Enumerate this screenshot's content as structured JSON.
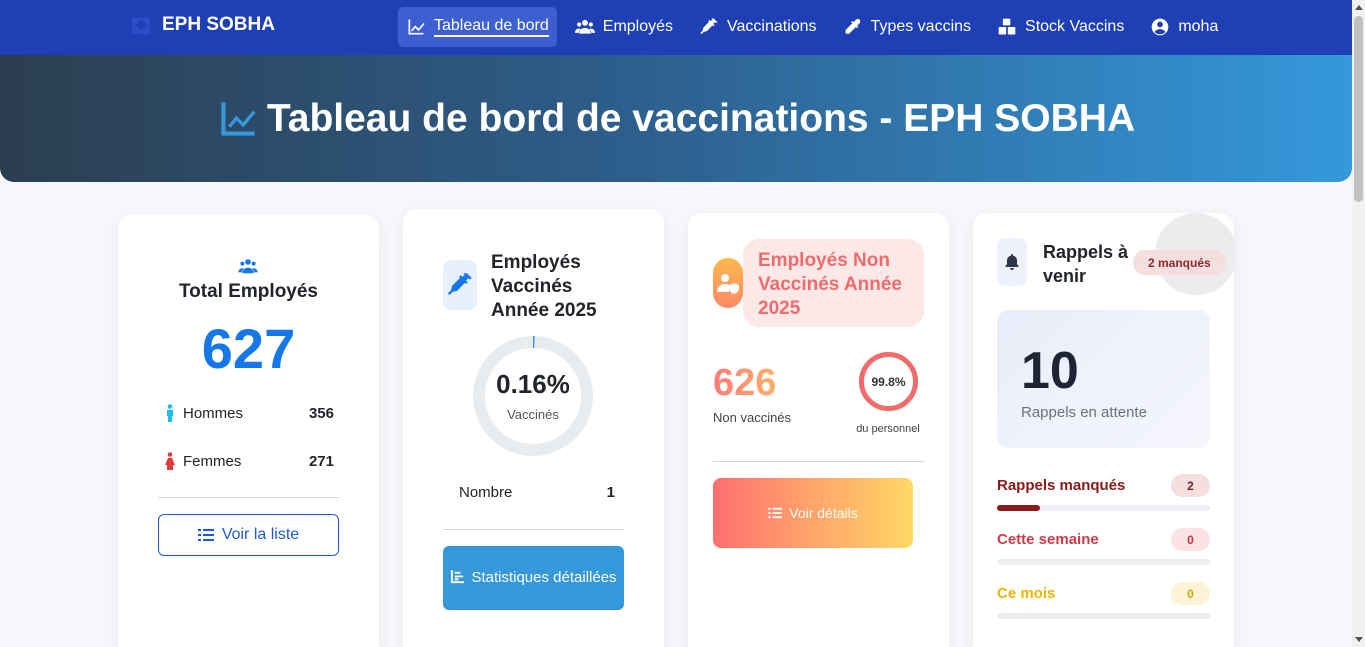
{
  "brand": {
    "name": "EPH SOBHA",
    "icon": "hospital-icon"
  },
  "nav": [
    {
      "label": "Tableau de bord",
      "icon": "chart-line-icon",
      "active": true
    },
    {
      "label": "Employés",
      "icon": "users-icon"
    },
    {
      "label": "Vaccinations",
      "icon": "syringe-icon"
    },
    {
      "label": "Types vaccins",
      "icon": "eyedropper-icon"
    },
    {
      "label": "Stock Vaccins",
      "icon": "boxes-icon"
    },
    {
      "label": "moha",
      "icon": "user-circle-icon"
    }
  ],
  "hero": {
    "title": "Tableau de bord de vaccinations - EPH SOBHA",
    "icon": "chart-line-icon"
  },
  "total": {
    "title": "Total Employés",
    "count": "627",
    "men_label": "Hommes",
    "men_value": "356",
    "women_label": "Femmes",
    "women_value": "271",
    "button": "Voir la liste"
  },
  "vaccinated": {
    "title": "Employés Vaccinés Année 2025",
    "percent": "0.16%",
    "percent_value": 0.16,
    "percent_label": "Vaccinés",
    "count_label": "Nombre",
    "count_value": "1",
    "button": "Statistiques détaillées"
  },
  "unvaccinated": {
    "title": "Employés Non Vaccinés Année 2025",
    "count": "626",
    "count_label": "Non vaccinés",
    "percent": "99.8%",
    "percent_value": 99.8,
    "percent_label": "du personnel",
    "button": "Voir détails"
  },
  "reminders": {
    "title": "Rappels à venir",
    "missed_badge": "2 manqués",
    "pending_count": "10",
    "pending_label": "Rappels en attente",
    "stats": [
      {
        "label": "Rappels manqués",
        "value": "2",
        "fraction": 0.2,
        "color": "#8b1a1a"
      },
      {
        "label": "Cette semaine",
        "value": "0",
        "fraction": 0,
        "color": "#d13a4a"
      },
      {
        "label": "Ce mois",
        "value": "0",
        "fraction": 0,
        "color": "#f0b400"
      }
    ]
  },
  "colors": {
    "navbar": "#1f3fb5",
    "primary": "#1677e8",
    "accent": "#3498db",
    "danger": "#f06b6b"
  }
}
